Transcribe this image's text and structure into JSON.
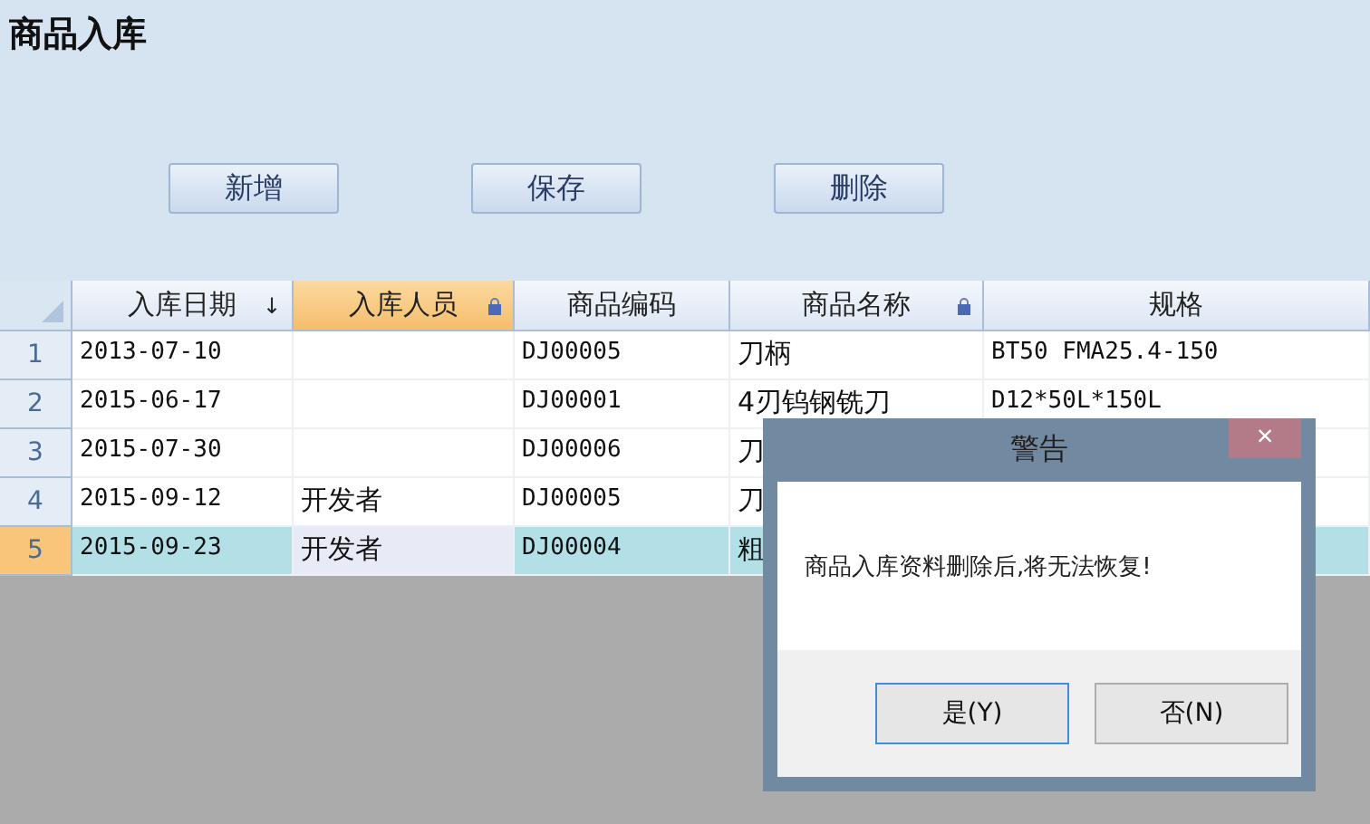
{
  "title": "商品入库",
  "toolbar": [
    "新增",
    "保存",
    "删除"
  ],
  "grid": {
    "columns": [
      {
        "label": "入库日期",
        "sort": "↓",
        "locked": false,
        "selected": false
      },
      {
        "label": "入库人员",
        "locked": true,
        "selected": true
      },
      {
        "label": "商品编码",
        "locked": false,
        "selected": false
      },
      {
        "label": "商品名称",
        "locked": true,
        "selected": false
      },
      {
        "label": "规格",
        "locked": false,
        "selected": false
      }
    ],
    "rows": [
      {
        "number": "1",
        "cells": [
          "2013-07-10",
          "",
          "DJ00005",
          "刀柄",
          "BT50 FMA25.4-150"
        ],
        "selected": false
      },
      {
        "number": "2",
        "cells": [
          "2015-06-17",
          "",
          "DJ00001",
          "4刃钨钢铣刀",
          "D12*50L*150L"
        ],
        "selected": false
      },
      {
        "number": "3",
        "cells": [
          "2015-07-30",
          "",
          "DJ00006",
          "刀",
          ""
        ],
        "selected": false
      },
      {
        "number": "4",
        "cells": [
          "2015-09-12",
          "开发者",
          "DJ00005",
          "刀",
          ""
        ],
        "selected": false
      },
      {
        "number": "5",
        "cells": [
          "2015-09-23",
          "开发者",
          "DJ00004",
          "粗",
          ""
        ],
        "selected": true
      }
    ]
  },
  "dialog": {
    "title": "警告",
    "close": "×",
    "message": "商品入库资料删除后,将无法恢复!",
    "buttons": [
      {
        "label": "是(Y)",
        "focused": true
      },
      {
        "label": "否(N)",
        "focused": false
      }
    ]
  }
}
